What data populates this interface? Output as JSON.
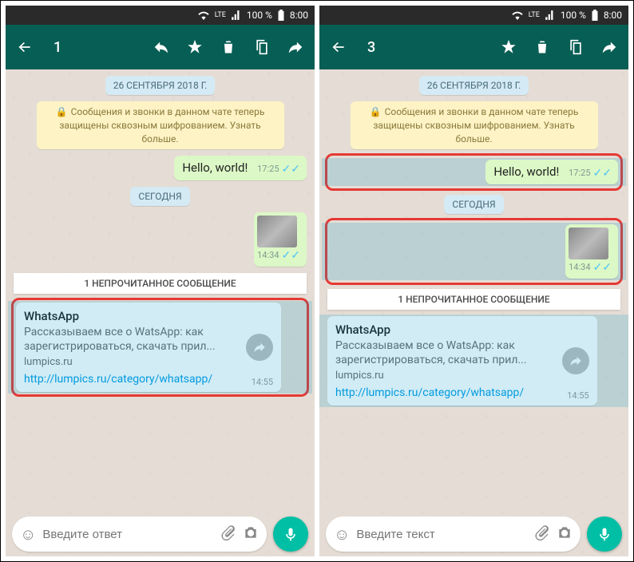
{
  "status": {
    "battery": "100 %",
    "time": "8:00",
    "lte": "LTE"
  },
  "left": {
    "count": "1",
    "date": "26 СЕНТЯБРЯ 2018 Г.",
    "encryption": "Сообщения и звонки в данном чате теперь защищены сквозным шифрованием. Узнать больше.",
    "msg1": {
      "text": "Hello, world!",
      "time": "17:25"
    },
    "today": "СЕГОДНЯ",
    "img": {
      "time": "14:34"
    },
    "unread": "1 НЕПРОЧИТАННОЕ СООБЩЕНИЕ",
    "link": {
      "title": "WhatsApp",
      "desc": "Рассказываем все о WatsApp: как зарегистрироваться, скачать прил...",
      "domain": "lumpics.ru",
      "url": "http://lumpics.ru/category/whatsapp/",
      "time": "14:55"
    },
    "input_placeholder": "Введите ответ"
  },
  "right": {
    "count": "3",
    "date": "26 СЕНТЯБРЯ 2018 Г.",
    "encryption": "Сообщения и звонки в данном чате теперь защищены сквозным шифрованием. Узнать больше.",
    "msg1": {
      "text": "Hello, world!",
      "time": "17:25"
    },
    "today": "СЕГОДНЯ",
    "img": {
      "time": "14:34"
    },
    "unread": "1 НЕПРОЧИТАННОЕ СООБЩЕНИЕ",
    "link": {
      "title": "WhatsApp",
      "desc": "Рассказываем все о WatsApp: как зарегистрироваться, скачать прил...",
      "domain": "lumpics.ru",
      "url": "http://lumpics.ru/category/whatsapp/",
      "time": "14:55"
    },
    "input_placeholder": "Введите текст"
  }
}
